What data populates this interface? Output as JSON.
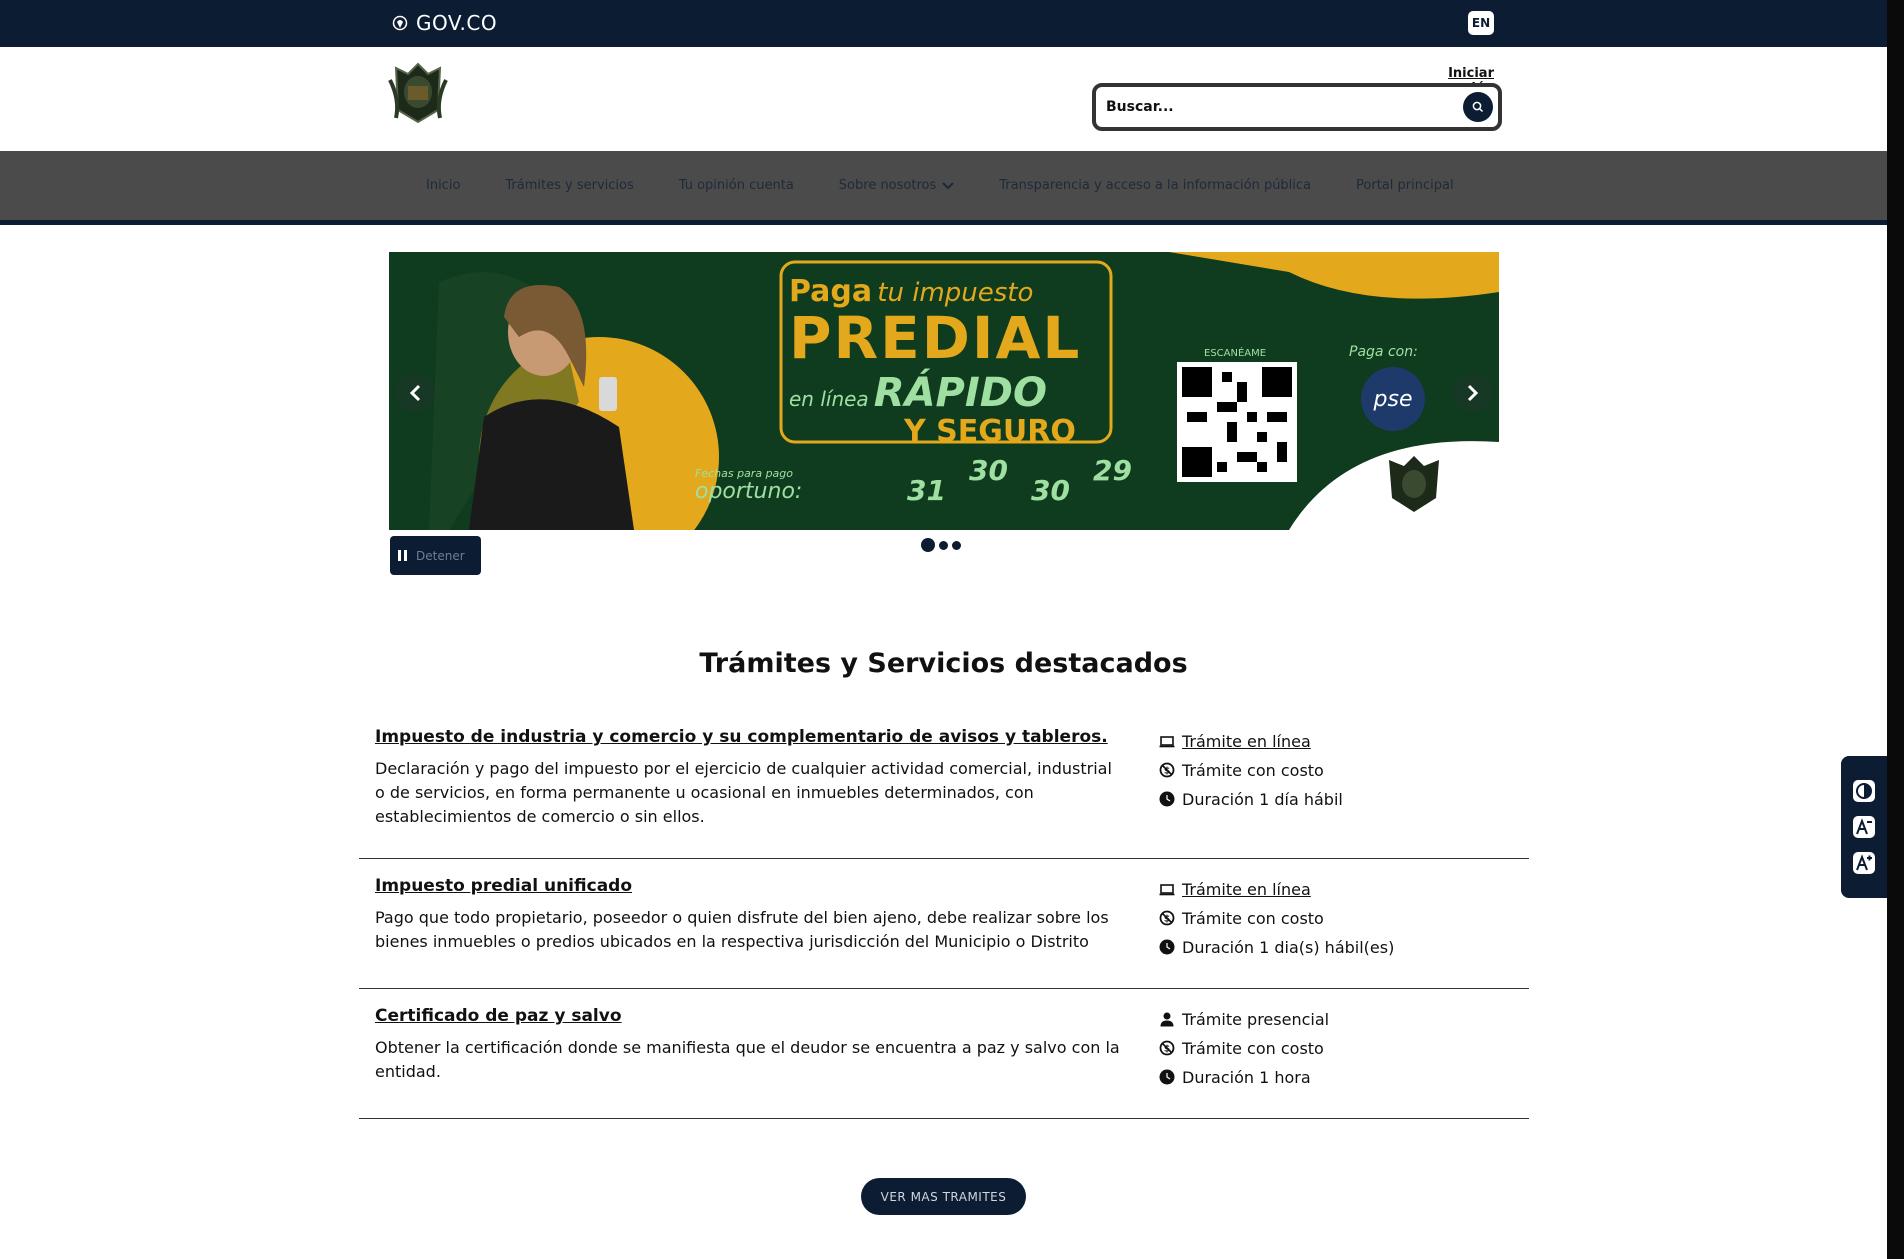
{
  "gov_bar": {
    "logo_text": "GOV.CO",
    "language_button": "EN",
    "background_color": "#0c1c33"
  },
  "header": {
    "login_link": "Iniciar sesión",
    "search": {
      "placeholder": "Buscar...",
      "button_icon": "search-icon"
    }
  },
  "nav": {
    "items": [
      {
        "label": "Inicio"
      },
      {
        "label": "Trámites y servicios"
      },
      {
        "label": "Tu opinión cuenta"
      },
      {
        "label": "Sobre nosotros",
        "icon": "chevron-down-icon"
      },
      {
        "label": "Transparencia y acceso a la información pública"
      },
      {
        "label": "Portal principal"
      }
    ]
  },
  "carousel": {
    "slide": {
      "line1_bold": "Paga",
      "line1_light": "tu impuesto",
      "line2": "PREDIAL",
      "line3_light": "en línea",
      "line3_bold": "RÁPIDO",
      "line4": "Y SEGURO",
      "dates_label_small": "Fechas para pago",
      "dates_label": "oportuno:",
      "dates": [
        "31",
        "30",
        "30",
        "29"
      ],
      "qr_label": "ESCANÉAME",
      "pay_with": "Paga con:",
      "pay_logo": "pse"
    },
    "pause_label": "Detener",
    "slide_count": 3,
    "active_slide": 1
  },
  "section": {
    "title": "Trámites y Servicios destacados"
  },
  "services": [
    {
      "title": "Impuesto de industria y comercio y su complementario de avisos y tableros.",
      "description": "Declaración y pago del impuesto por el ejercicio de cualquier actividad comercial, industrial o de servicios, en forma permanente u ocasional en inmuebles determinados, con establecimientos de comercio o sin ellos.",
      "meta": [
        {
          "icon": "laptop-icon",
          "text": "Trámite en línea",
          "link": true
        },
        {
          "icon": "no-money-icon",
          "text": "Trámite con costo",
          "link": false
        },
        {
          "icon": "clock-icon",
          "text": "Duración 1 día hábil",
          "link": false
        }
      ]
    },
    {
      "title": "Impuesto predial unificado",
      "description": "Pago que todo propietario, poseedor o quien disfrute del bien ajeno, debe realizar sobre los bienes inmuebles o predios ubicados en la respectiva jurisdicción del Municipio o Distrito",
      "meta": [
        {
          "icon": "laptop-icon",
          "text": "Trámite en línea",
          "link": true
        },
        {
          "icon": "no-money-icon",
          "text": "Trámite con costo",
          "link": false
        },
        {
          "icon": "clock-icon",
          "text": "Duración 1 dia(s) hábil(es)",
          "link": false
        }
      ]
    },
    {
      "title": "Certificado de paz y salvo",
      "description": "Obtener la certificación donde se manifiesta que el deudor se encuentra a paz y salvo con la entidad.",
      "meta": [
        {
          "icon": "person-icon",
          "text": "Trámite presencial",
          "link": false
        },
        {
          "icon": "no-money-icon",
          "text": "Trámite con costo",
          "link": false
        },
        {
          "icon": "clock-icon",
          "text": "Duración 1 hora",
          "link": false
        }
      ]
    }
  ],
  "more_button": "VER MAS TRAMITES",
  "accessibility": {
    "buttons": [
      "contrast-icon",
      "decrease-font-icon",
      "increase-font-icon"
    ]
  }
}
